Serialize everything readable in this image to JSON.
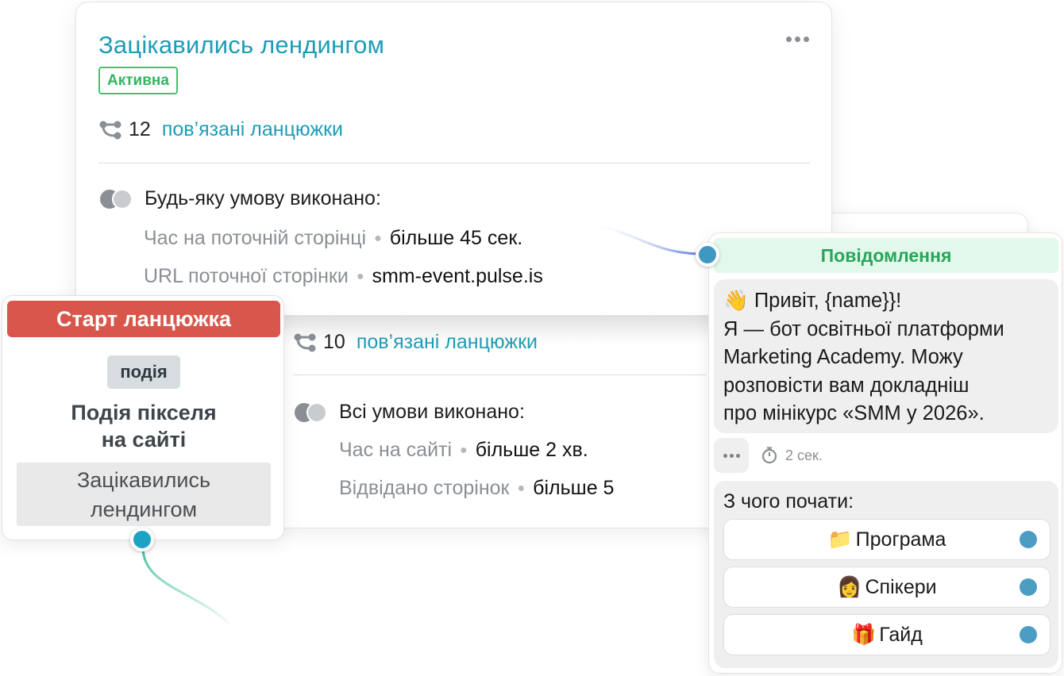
{
  "rule_card": {
    "title": "Зацікавились лендингом",
    "status": "Активна",
    "linked_count": "12",
    "linked_label": "пов’язані ланцюжки",
    "condition_mode": "Будь-яку умову виконано:",
    "conditions": [
      {
        "key": "Час на поточній сторінці",
        "value": "більше 45 сек."
      },
      {
        "key": "URL поточної сторінки",
        "value": "smm-event.pulse.is"
      }
    ]
  },
  "rule_card_2": {
    "linked_count": "10",
    "linked_label": "пов’язані ланцюжки",
    "condition_mode": "Всі умови виконано:",
    "conditions": [
      {
        "key": "Час на сайті",
        "value": "більше 2 хв."
      },
      {
        "key": "Відвідано сторінок",
        "value": "більше 5"
      }
    ]
  },
  "start_card": {
    "header": "Старт ланцюжка",
    "chip": "подія",
    "title_line1": "Подія пікселя",
    "title_line2": "на сайті",
    "value_line1": "Зацікавились",
    "value_line2": "лендингом"
  },
  "message_card": {
    "header": "Повідомлення",
    "lines": [
      "👋 Привіт, {name}}!",
      "Я — бот освітньої платформи",
      "Marketing Academy.  Можу",
      "розповісти вам докладніш",
      "про мінікурс «SMM у 2026»."
    ],
    "delay": "2 сек.",
    "buttons_title": "З чого почати:",
    "buttons": [
      {
        "emoji": "📁",
        "label": "Програма"
      },
      {
        "emoji": "👩",
        "label": "Спікери"
      },
      {
        "emoji": "🎁",
        "label": "Гайд"
      }
    ]
  },
  "colors": {
    "accent": "#1d9cb6",
    "active_green": "#2fb560",
    "start_red": "#d9564b",
    "message_green_bg": "#e2f8ea",
    "port_blue": "#1aa3c2"
  },
  "icons": [
    "more-icon",
    "chain-icon",
    "venn-icon",
    "timer-icon",
    "folder-emoji",
    "woman-emoji",
    "gift-emoji"
  ]
}
